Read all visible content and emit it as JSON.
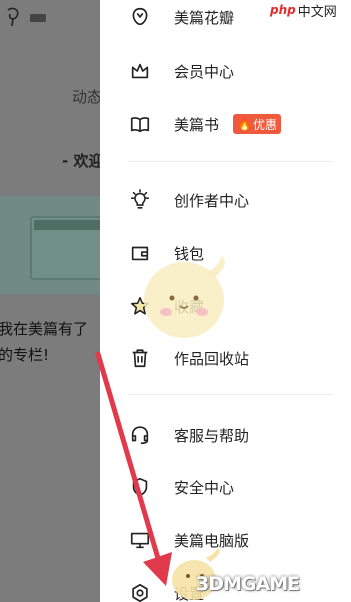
{
  "background_page": {
    "tab_label": "动态",
    "welcome_text": "- 欢迎",
    "promo_line1": "我在美篇有了",
    "promo_line2": "的专栏!"
  },
  "drawer": {
    "items": [
      {
        "label": "美篇花瓣",
        "icon": "flower-icon"
      },
      {
        "label": "会员中心",
        "icon": "crown-icon"
      },
      {
        "label": "美篇书",
        "icon": "book-icon",
        "badge": "优惠",
        "badge_icon": "fire-icon"
      },
      {
        "label": "创作者中心",
        "icon": "bulb-icon"
      },
      {
        "label": "钱包",
        "icon": "wallet-icon"
      },
      {
        "label": "收藏",
        "icon": "star-icon"
      },
      {
        "label": "作品回收站",
        "icon": "trash-icon"
      },
      {
        "label": "客服与帮助",
        "icon": "headset-icon"
      },
      {
        "label": "安全中心",
        "icon": "shield-icon"
      },
      {
        "label": "美篇电脑版",
        "icon": "monitor-icon"
      },
      {
        "label": "设置",
        "icon": "gear-icon"
      }
    ]
  },
  "watermarks": {
    "top_right_brand": "php",
    "top_right_text": "中文网",
    "bottom_right": "3DMGAME"
  },
  "colors": {
    "accent_badge": "#f05a3c",
    "arrow": "#e23a4d",
    "dim_overlay": "#7c7c7c"
  }
}
